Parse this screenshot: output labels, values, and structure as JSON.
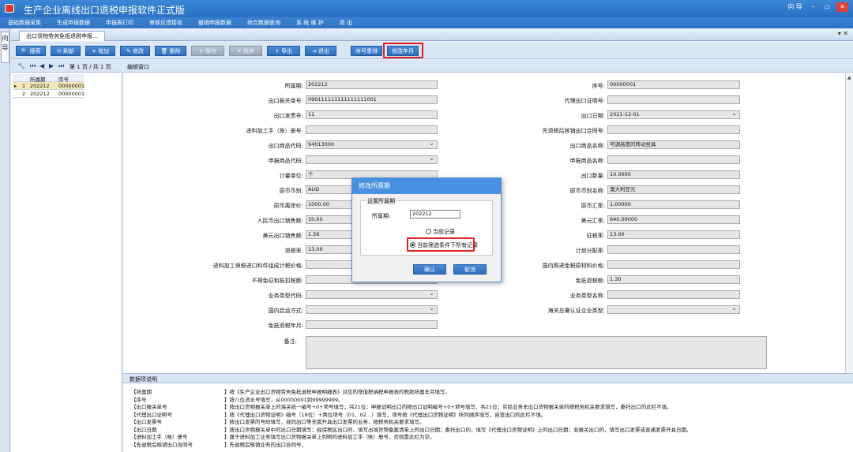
{
  "app": {
    "title": "生产企业离线出口退税申报软件正式版"
  },
  "window_controls": {
    "guide": "向 导",
    "minimize": "–",
    "restore": "▭",
    "close": "✕"
  },
  "menu": [
    "基础数据采集",
    "生成申报数据",
    "申报表打印",
    "审核反馈接收",
    "撤销申报数据",
    "综合数据查询",
    "系 统 维 护",
    "退 出"
  ],
  "vertical_nav": {
    "label": "向导"
  },
  "doc_tab": {
    "label": "出口货物劳务免抵退税申报…",
    "close": "▾ ✕"
  },
  "toolbar": {
    "search": "搜索",
    "refresh": "刷新",
    "add": "增加",
    "edit": "修改",
    "delete": "删除",
    "save": "保存",
    "cancel": "放弃",
    "import": "导出",
    "exit": "退出",
    "renumber": "序号重排",
    "change_period": "修改年月"
  },
  "grid": {
    "pager": "第 1 页 / 共 1 页",
    "headers": [
      "所属期",
      "序号"
    ],
    "rows": [
      {
        "idx": "1",
        "period": "202212",
        "seq": "00000001"
      },
      {
        "idx": "2",
        "period": "202212",
        "seq": "00000001"
      }
    ]
  },
  "edit_window": {
    "title": "编辑窗口"
  },
  "form": {
    "left": [
      {
        "label": "所属期:",
        "value": "202212"
      },
      {
        "label": "出口报关单号:",
        "value": "090111111111111111001"
      },
      {
        "label": "出口发票号:",
        "value": "11"
      },
      {
        "label": "进料加工手（账）册号:",
        "value": ""
      },
      {
        "label": "出口商品代码:",
        "value": "94013000"
      },
      {
        "label": "申报商品代码:",
        "value": ""
      },
      {
        "label": "计量单位:",
        "value": "个"
      },
      {
        "label": "原币币别:",
        "value": "AUD"
      },
      {
        "label": "原币离岸价:",
        "value": "1000.00"
      },
      {
        "label": "人民币出口销售额:",
        "value": "10.00"
      },
      {
        "label": "美元出口销售额:",
        "value": "1.56"
      },
      {
        "label": "退税率:",
        "value": "13.00"
      },
      {
        "label": "进料加工保税进口料件组成计税价格:",
        "value": ""
      },
      {
        "label": "不得免征和抵扣税额:",
        "value": ""
      },
      {
        "label": "业务类型代码:",
        "value": ""
      },
      {
        "label": "国内启运方式:",
        "value": ""
      },
      {
        "label": "免抵退税年月:",
        "value": ""
      }
    ],
    "right": [
      {
        "label": "序号:",
        "value": "00000001"
      },
      {
        "label": "代理出口证明号:",
        "value": ""
      },
      {
        "label": "出口日期:",
        "value": "2021-12-01"
      },
      {
        "label": "先退税后核销出口合同号:",
        "value": ""
      },
      {
        "label": "出口商品名称:",
        "value": "可调高度的转动坐具"
      },
      {
        "label": "申报商品名称:",
        "value": ""
      },
      {
        "label": "出口数量:",
        "value": "10.0000"
      },
      {
        "label": "原币币别名称:",
        "value": "澳大利亚元"
      },
      {
        "label": "原币汇率:",
        "value": "1.00000"
      },
      {
        "label": "美元汇率:",
        "value": "640.09000"
      },
      {
        "label": "征税率:",
        "value": "13.00"
      },
      {
        "label": "计划分配率:",
        "value": ""
      },
      {
        "label": "国内购进免税原材料价格:",
        "value": ""
      },
      {
        "label": "免抵退税额:",
        "value": "1.30"
      },
      {
        "label": "业务类型名称:",
        "value": ""
      },
      {
        "label": "海关总署认证企业类型:",
        "value": ""
      }
    ],
    "remark_label": "备注:"
  },
  "dialog": {
    "title": "修改所属期",
    "group": "设置所属期",
    "period_label": "所属期:",
    "period_value": "202212",
    "opt_current": "当前记录",
    "opt_all": "当前筛选条件下所有记录",
    "ok": "确认",
    "cancel": "取消"
  },
  "desc": {
    "title": "数据项说明",
    "rows": [
      {
        "k": "【所属期",
        "v": "】按《生产企业出口货物劳务免抵退税申报明细表》对应的增值税纳税申报表的税款所属年月填写。"
      },
      {
        "k": "【序号",
        "v": "】按八位流水号填写，从00000001到99999999。"
      },
      {
        "k": "【出口报关单号",
        "v": "】按出口货物报关单上的海关统一编号+0+项号填写，共21位；申报证明出口的按出口证明编号+0+项号填写，共21位；实际业务无出口货物报关单的按税务机关要求填写，委托出口的此栏不填。"
      },
      {
        "k": "【代理出口证明号",
        "v": "】按《代理出口货物证明》编号（18位）+两位项号（01、02…）填写，项号按《代理出口货物证明》所列顺序填写，自营出口的此栏不填。"
      },
      {
        "k": "【出口发票号",
        "v": "】按出口发票的号码填写，视同出口等无需开具出口发票的业务，按税务机关要求填写。"
      },
      {
        "k": "【出口日期",
        "v": "】按出口货物报关单中的出口日期填写；经保税区出口的，填写出境货物备案清单上的出口日期；委托出口的，填写《代理出口货物证明》上的出口日期；非报关出口的，填写出口发票或普通发票开具日期。"
      },
      {
        "k": "【进料加工手（账）册号",
        "v": "】属于进料加工业务填写出口货物报关单上列明的进料加工手（账）册号，否则置此栏为空。"
      },
      {
        "k": "【先退税后核销出口合同号",
        "v": "】先退税后核销业务的出口合同号。"
      }
    ]
  }
}
